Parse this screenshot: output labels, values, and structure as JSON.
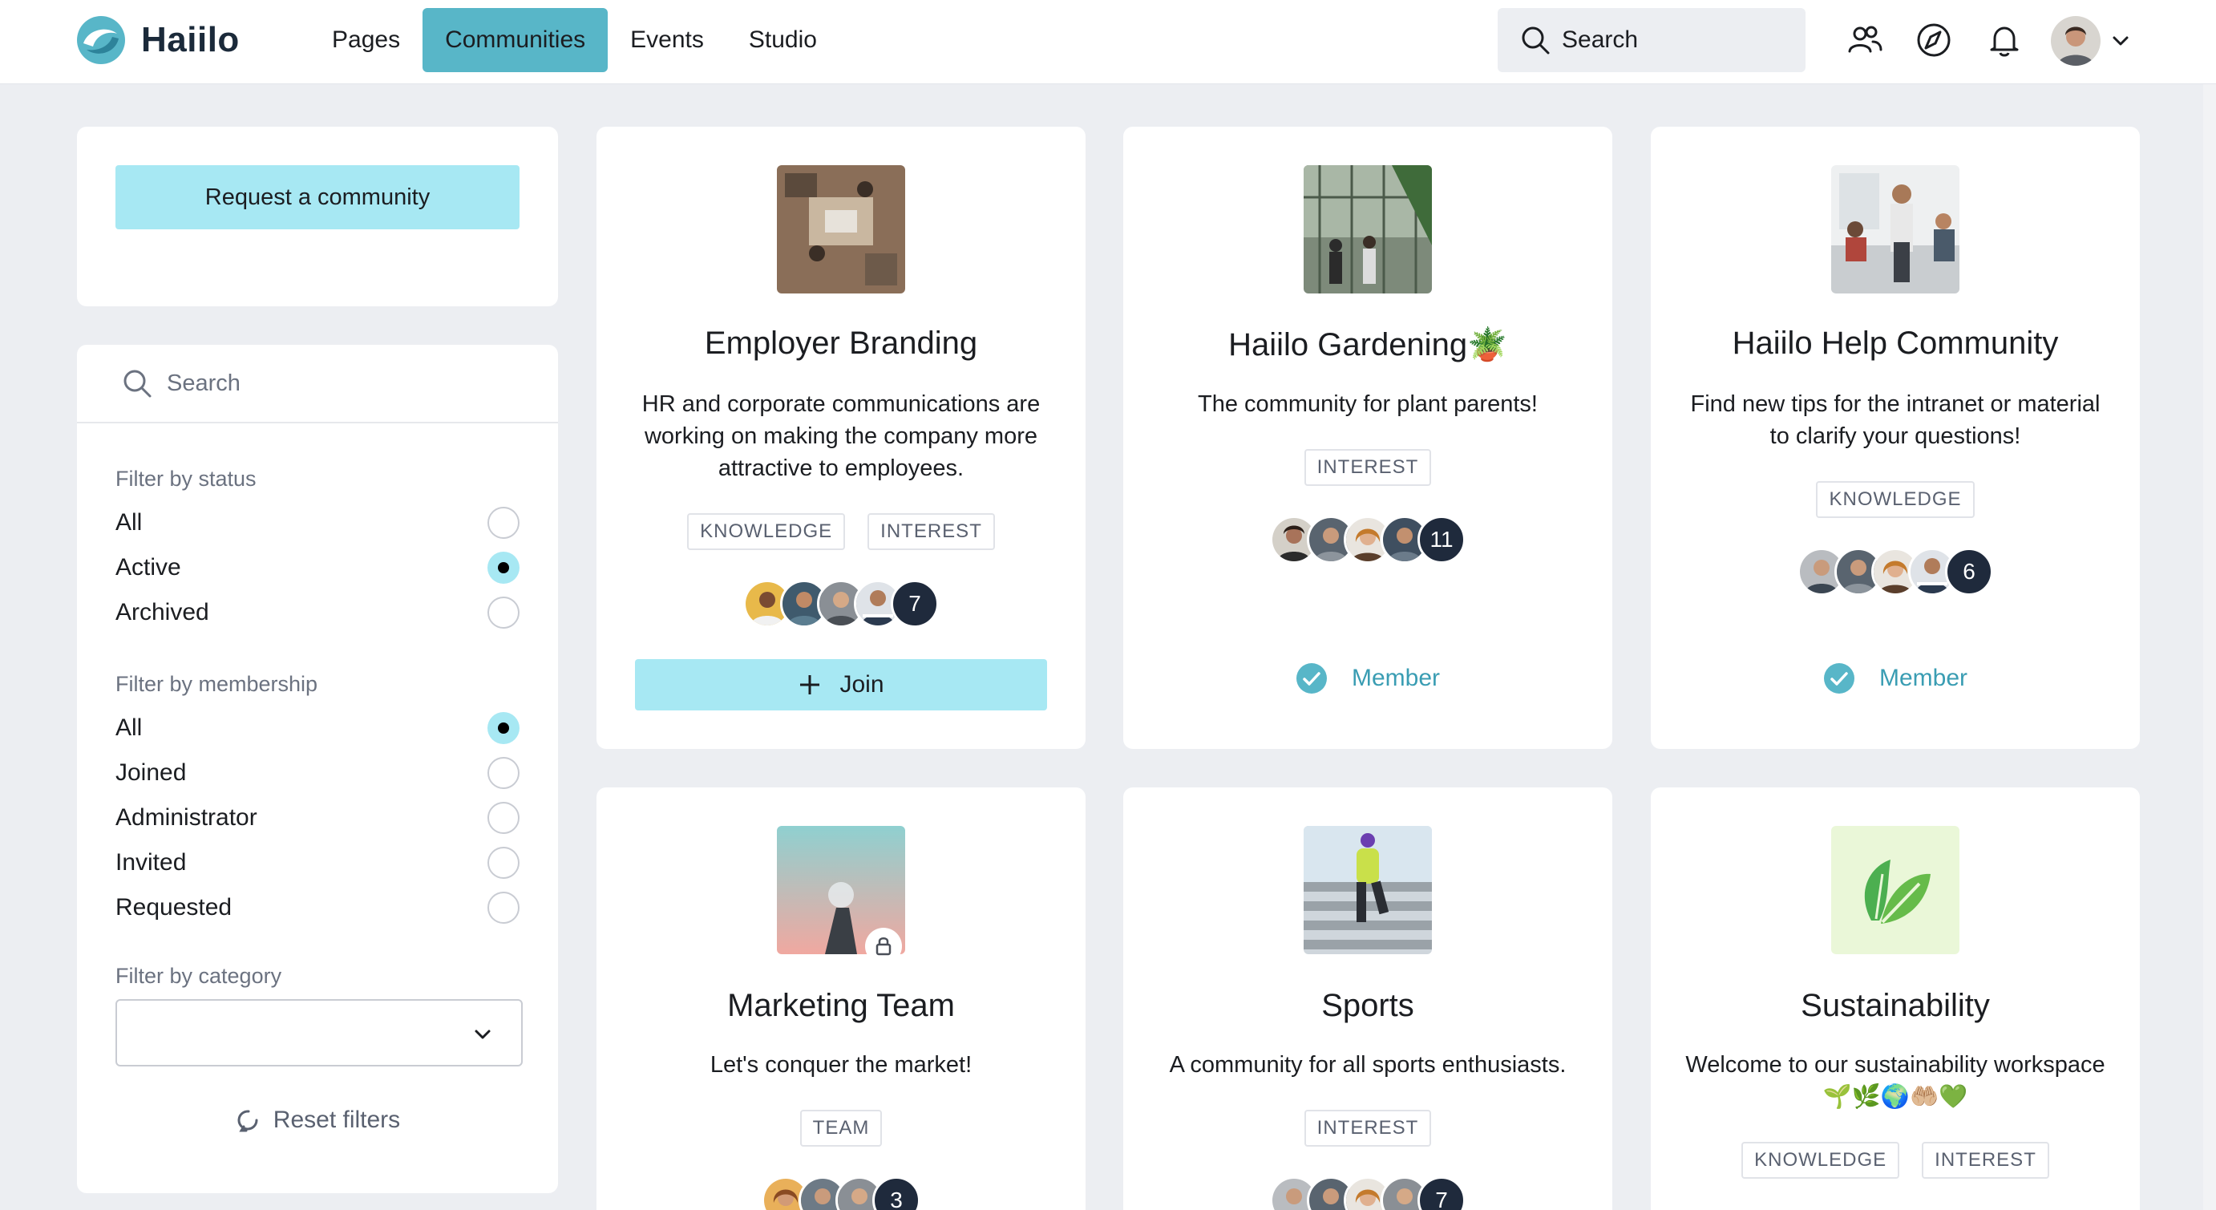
{
  "header": {
    "logo_text": "Haiilo",
    "nav": [
      {
        "label": "Pages",
        "active": false
      },
      {
        "label": "Communities",
        "active": true
      },
      {
        "label": "Events",
        "active": false
      },
      {
        "label": "Studio",
        "active": false
      }
    ],
    "search_label": "Search",
    "icons": [
      "people-icon",
      "compass-icon",
      "bell-icon",
      "avatar",
      "chevron-down-icon"
    ]
  },
  "sidebar": {
    "request_button": "Request a community",
    "search_placeholder": "Search",
    "status_title": "Filter by status",
    "status_options": [
      {
        "label": "All",
        "selected": false
      },
      {
        "label": "Active",
        "selected": true
      },
      {
        "label": "Archived",
        "selected": false
      }
    ],
    "membership_title": "Filter by membership",
    "membership_options": [
      {
        "label": "All",
        "selected": true
      },
      {
        "label": "Joined",
        "selected": false
      },
      {
        "label": "Administrator",
        "selected": false
      },
      {
        "label": "Invited",
        "selected": false
      },
      {
        "label": "Requested",
        "selected": false
      }
    ],
    "category_title": "Filter by category",
    "category_value": "",
    "reset_label": "Reset filters"
  },
  "cards": [
    {
      "title": "Employer Branding",
      "description": "HR and corporate communications are working on making the company more attractive to employees.",
      "tags": [
        "KNOWLEDGE",
        "INTEREST"
      ],
      "member_count": "7",
      "action": "Join"
    },
    {
      "title": "Haiilo Gardening🪴",
      "description": "The community for plant parents!",
      "tags": [
        "INTEREST"
      ],
      "member_count": "11",
      "action": "Member"
    },
    {
      "title": "Haiilo Help Community",
      "description": "Find new tips for the intranet or material to clarify your questions!",
      "tags": [
        "KNOWLEDGE"
      ],
      "member_count": "6",
      "action": "Member"
    },
    {
      "title": "Marketing Team",
      "description": "Let's conquer the market!",
      "tags": [
        "TEAM"
      ],
      "member_count": "3",
      "action": ""
    },
    {
      "title": "Sports",
      "description": "A community for all sports enthusiasts.",
      "tags": [
        "INTEREST"
      ],
      "member_count": "7",
      "action": ""
    },
    {
      "title": "Sustainability",
      "description": "Welcome to our sustainability workspace 🌱🌿🌍🤲🏼💚",
      "tags": [
        "KNOWLEDGE",
        "INTEREST"
      ],
      "member_count": "",
      "action": ""
    }
  ],
  "colors": {
    "accent": "#58b6c8",
    "button_bg": "#a7e8f3",
    "member_text": "#3a9db3",
    "page_bg": "#eceef2",
    "count_badge": "#1f2a3c"
  }
}
